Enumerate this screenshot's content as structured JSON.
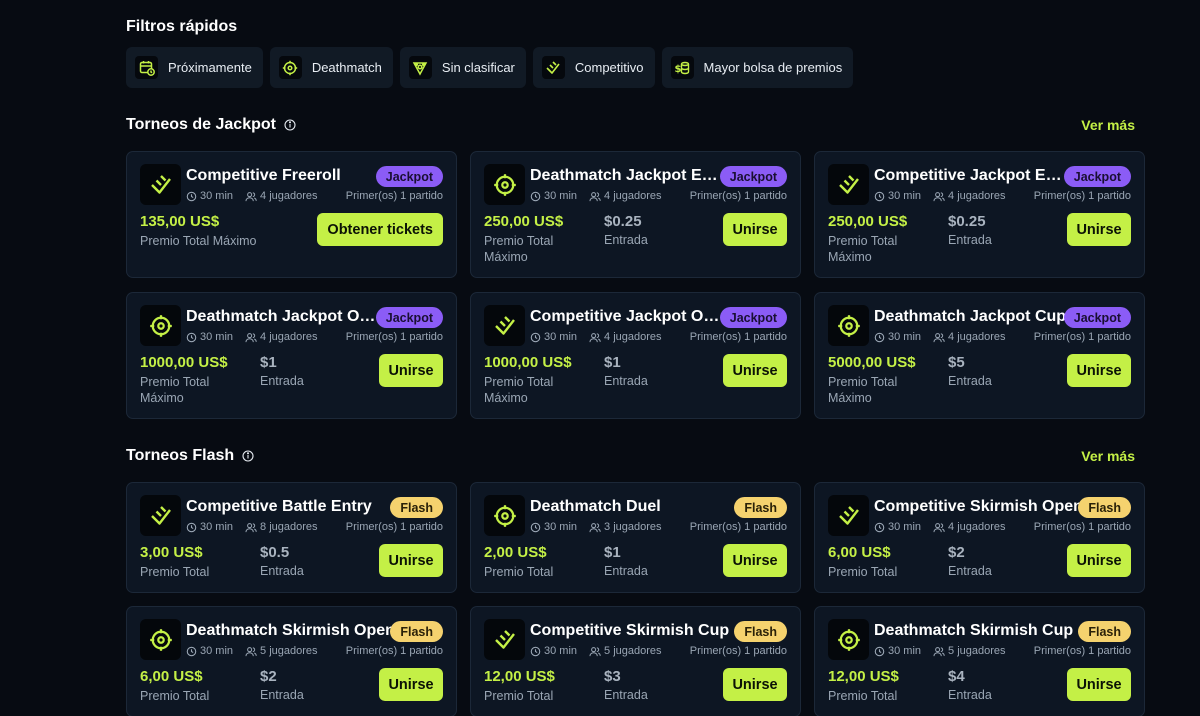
{
  "filters": {
    "title": "Filtros rápidos",
    "chips": [
      {
        "label": "Próximamente",
        "icon": "calendar-clock-icon"
      },
      {
        "label": "Deathmatch",
        "icon": "crosshair-icon"
      },
      {
        "label": "Sin clasificar",
        "icon": "unranked-icon"
      },
      {
        "label": "Competitivo",
        "icon": "competitive-icon"
      },
      {
        "label": "Mayor bolsa de premios",
        "icon": "money-icon"
      }
    ]
  },
  "jackpot": {
    "title": "Torneos de Jackpot",
    "see_more": "Ver más",
    "cards": [
      {
        "title": "Competitive Freeroll",
        "badge": "Jackpot",
        "time": "30 min",
        "players": "4 jugadores",
        "first": "Primer(os) 1 partido",
        "prize": "135,00 US$",
        "prize_label": "Premio Total Máximo",
        "entry": "",
        "entry_label": "",
        "button": "Obtener tickets"
      },
      {
        "title": "Deathmatch Jackpot Entry",
        "badge": "Jackpot",
        "time": "30 min",
        "players": "4 jugadores",
        "first": "Primer(os) 1 partido",
        "prize": "250,00 US$",
        "prize_label": "Premio Total Máximo",
        "entry": "$0.25",
        "entry_label": "Entrada",
        "button": "Unirse"
      },
      {
        "title": "Competitive Jackpot Entry",
        "badge": "Jackpot",
        "time": "30 min",
        "players": "4 jugadores",
        "first": "Primer(os) 1 partido",
        "prize": "250,00 US$",
        "prize_label": "Premio Total Máximo",
        "entry": "$0.25",
        "entry_label": "Entrada",
        "button": "Unirse"
      },
      {
        "title": "Deathmatch Jackpot Open",
        "badge": "Jackpot",
        "time": "30 min",
        "players": "4 jugadores",
        "first": "Primer(os) 1 partido",
        "prize": "1000,00 US$",
        "prize_label": "Premio Total Máximo",
        "entry": "$1",
        "entry_label": "Entrada",
        "button": "Unirse"
      },
      {
        "title": "Competitive Jackpot Open",
        "badge": "Jackpot",
        "time": "30 min",
        "players": "4 jugadores",
        "first": "Primer(os) 1 partido",
        "prize": "1000,00 US$",
        "prize_label": "Premio Total Máximo",
        "entry": "$1",
        "entry_label": "Entrada",
        "button": "Unirse"
      },
      {
        "title": "Deathmatch Jackpot Cup",
        "badge": "Jackpot",
        "time": "30 min",
        "players": "4 jugadores",
        "first": "Primer(os) 1 partido",
        "prize": "5000,00 US$",
        "prize_label": "Premio Total Máximo",
        "entry": "$5",
        "entry_label": "Entrada",
        "button": "Unirse"
      }
    ]
  },
  "flash": {
    "title": "Torneos Flash",
    "see_more": "Ver más",
    "cards": [
      {
        "title": "Competitive Battle Entry",
        "badge": "Flash",
        "time": "30 min",
        "players": "8 jugadores",
        "first": "Primer(os) 1 partido",
        "prize": "3,00 US$",
        "prize_label": "Premio Total",
        "entry": "$0.5",
        "entry_label": "Entrada",
        "button": "Unirse"
      },
      {
        "title": "Deathmatch Duel",
        "badge": "Flash",
        "time": "30 min",
        "players": "3 jugadores",
        "first": "Primer(os) 1 partido",
        "prize": "2,00 US$",
        "prize_label": "Premio Total",
        "entry": "$1",
        "entry_label": "Entrada",
        "button": "Unirse"
      },
      {
        "title": "Competitive Skirmish Open",
        "badge": "Flash",
        "time": "30 min",
        "players": "4 jugadores",
        "first": "Primer(os) 1 partido",
        "prize": "6,00 US$",
        "prize_label": "Premio Total",
        "entry": "$2",
        "entry_label": "Entrada",
        "button": "Unirse"
      },
      {
        "title": "Deathmatch Skirmish Open",
        "badge": "Flash",
        "time": "30 min",
        "players": "5 jugadores",
        "first": "Primer(os) 1 partido",
        "prize": "6,00 US$",
        "prize_label": "Premio Total",
        "entry": "$2",
        "entry_label": "Entrada",
        "button": "Unirse"
      },
      {
        "title": "Competitive Skirmish Cup",
        "badge": "Flash",
        "time": "30 min",
        "players": "5 jugadores",
        "first": "Primer(os) 1 partido",
        "prize": "12,00 US$",
        "prize_label": "Premio Total",
        "entry": "$3",
        "entry_label": "Entrada",
        "button": "Unirse"
      },
      {
        "title": "Deathmatch Skirmish Cup",
        "badge": "Flash",
        "time": "30 min",
        "players": "5 jugadores",
        "first": "Primer(os) 1 partido",
        "prize": "12,00 US$",
        "prize_label": "Premio Total",
        "entry": "$4",
        "entry_label": "Entrada",
        "button": "Unirse"
      }
    ]
  },
  "colors": {
    "accent": "#c4f046",
    "jackpot_badge": "#8b5cf6",
    "flash_badge": "#f5d26e",
    "card_bg": "#0d1623",
    "page_bg": "#070b12"
  }
}
